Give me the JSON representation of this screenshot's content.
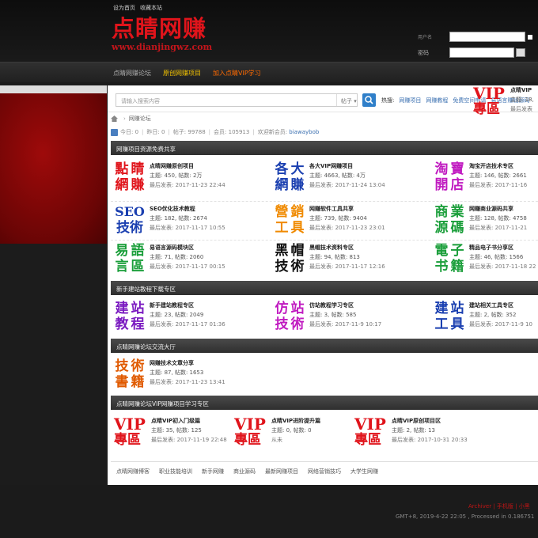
{
  "top": {
    "links": [
      "设为首页",
      "收藏本站"
    ],
    "logo_cn": "点睛网赚",
    "logo_en": "www.dianjingwz.com"
  },
  "login": {
    "user_label": "用户名",
    "password_label": "密码"
  },
  "nav": {
    "items": [
      "点睛网赚论坛",
      "原创网赚项目",
      "加入点睛VIP学习"
    ]
  },
  "search": {
    "placeholder": "请输入搜索内容",
    "scope": "帖子",
    "hot_label": "热搜:",
    "hot_items": [
      "网赚项目",
      "网赚教程",
      "免费空间申请",
      "易语言赚钱源码"
    ]
  },
  "breadcrumb": {
    "forum": "网赚论坛"
  },
  "stats": {
    "today": "今日: 0",
    "yesterday": "昨日: 0",
    "posts": "帖子: 99788",
    "members": "会员: 105913",
    "newest_label": "欢迎新会员:",
    "newest_user": "biawaybob"
  },
  "sections": [
    {
      "title": "网赚项目资源免费共享",
      "forums": [
        {
          "icon": [
            "點",
            "睛",
            "網",
            "賺"
          ],
          "colors": [
            "#e0141b",
            "#e0141b",
            "#e0141b",
            "#e0141b"
          ],
          "name": "点睛网赚原创项目",
          "meta": "主题: 450, 帖数: 2万",
          "last": "最后发表: 2017-11-23 22:44"
        },
        {
          "icon": [
            "各",
            "大",
            "網",
            "賺"
          ],
          "colors": [
            "#1a3fb0",
            "#1a3fb0",
            "#1a3fb0",
            "#1a3fb0"
          ],
          "name": "各大VIP网赚项目",
          "meta": "主题: 4663, 帖数: 4万",
          "last": "最后发表: 2017-11-24 13:04"
        },
        {
          "icon": [
            "淘",
            "寶",
            "開",
            "店"
          ],
          "colors": [
            "#c01ac0",
            "#c01ac0",
            "#c01ac0",
            "#c01ac0"
          ],
          "name": "淘宝开店技术专区",
          "meta": "主题: 146, 帖数: 2661",
          "last": "最后发表: 2017-11-16"
        },
        {
          "icon": [
            "S",
            "E",
            "技",
            "術"
          ],
          "colors": [
            "#1a3fb0",
            "#1a3fb0",
            "#1a3fb0",
            "#1a3fb0"
          ],
          "name": "SEO优化技术教程",
          "meta": "主题: 182, 帖数: 2674",
          "last": "最后发表: 2017-11-17 10:55",
          "seo": "SEO"
        },
        {
          "icon": [
            "營",
            "銷",
            "工",
            "具"
          ],
          "colors": [
            "#f08a00",
            "#f08a00",
            "#f08a00",
            "#f08a00"
          ],
          "name": "网赚软件工具共享",
          "meta": "主题: 739, 帖数: 9404",
          "last": "最后发表: 2017-11-23 23:01"
        },
        {
          "icon": [
            "商",
            "業",
            "源",
            "碼"
          ],
          "colors": [
            "#1a9e3a",
            "#1a9e3a",
            "#1a9e3a",
            "#1a9e3a"
          ],
          "name": "网赚商业源码共享",
          "meta": "主题: 128, 帖数: 4758",
          "last": "最后发表: 2017-11-21"
        },
        {
          "icon": [
            "易",
            "語",
            "言",
            "區"
          ],
          "colors": [
            "#1a9e3a",
            "#1a9e3a",
            "#1a9e3a",
            "#1a9e3a"
          ],
          "name": "易语言源码模块区",
          "meta": "主题: 71, 帖数: 2060",
          "last": "最后发表: 2017-11-17 00:15"
        },
        {
          "icon": [
            "黑",
            "帽",
            "技",
            "術"
          ],
          "colors": [
            "#111",
            "#111",
            "#111",
            "#111"
          ],
          "name": "黑帽技术资料专区",
          "meta": "主题: 94, 帖数: 813",
          "last": "最后发表: 2017-11-17 12:16"
        },
        {
          "icon": [
            "電",
            "子",
            "书",
            "籍"
          ],
          "colors": [
            "#1a9e3a",
            "#1a9e3a",
            "#1a9e3a",
            "#1a9e3a"
          ],
          "name": "精品电子书分享区",
          "meta": "主题: 46, 帖数: 1566",
          "last": "最后发表: 2017-11-18 22"
        }
      ]
    },
    {
      "title": "新手建站教程下载专区",
      "forums": [
        {
          "icon": [
            "建",
            "站",
            "教",
            "程"
          ],
          "colors": [
            "#7a1ac0",
            "#7a1ac0",
            "#7a1ac0",
            "#7a1ac0"
          ],
          "name": "新手建站教程专区",
          "meta": "主题: 23, 帖数: 2049",
          "last": "最后发表: 2017-11-17 01:36"
        },
        {
          "icon": [
            "仿",
            "站",
            "技",
            "術"
          ],
          "colors": [
            "#c01ac0",
            "#c01ac0",
            "#c01ac0",
            "#c01ac0"
          ],
          "name": "仿站教程学习专区",
          "meta": "主题: 3, 帖数: 585",
          "last": "最后发表: 2017-11-9 10:17"
        },
        {
          "icon": [
            "建",
            "站",
            "工",
            "具"
          ],
          "colors": [
            "#1a3fb0",
            "#1a3fb0",
            "#1a3fb0",
            "#1a3fb0"
          ],
          "name": "建站相关工具专区",
          "meta": "主题: 2, 帖数: 352",
          "last": "最后发表: 2017-11-9 10"
        }
      ]
    },
    {
      "title": "点睛网赚论坛交流大厅",
      "forums": [
        {
          "icon": [
            "技",
            "術",
            "書",
            "籍"
          ],
          "colors": [
            "#e05a00",
            "#e05a00",
            "#e05a00",
            "#e05a00"
          ],
          "name": "网赚技术文章分享",
          "meta": "主题: 87, 帖数: 1653",
          "last": "最后发表: 2017-11-23 13:41"
        }
      ]
    },
    {
      "title": "点睛网赚论坛VIP网赚项目学习专区",
      "forums": [
        {
          "vip": [
            "VIP",
            "專區"
          ],
          "name": "点睛VIP初入门级篇",
          "meta": "主题: 35, 帖数: 125",
          "last": "最后发表: 2017-11-19 22:48"
        },
        {
          "vip": [
            "VIP",
            "專區"
          ],
          "name": "点睛VIP进阶提升篇",
          "meta": "主题: 0, 帖数: 0",
          "last": "从未"
        },
        {
          "vip": [
            "VIP",
            "專區"
          ],
          "name": "点睛VIP原创项目区",
          "meta": "主题: 2, 帖数: 13",
          "last": "最后发表: 2017-10-31 20:33"
        },
        {
          "vip": [
            "VIP",
            "專區"
          ],
          "name": "点睛VIP",
          "meta": "主题: 18,",
          "last": "最后发表"
        }
      ]
    }
  ],
  "bottom_links": [
    "点睛网赚博客",
    "职业技能培训",
    "新手网赚",
    "商业源码",
    "最新网赚项目",
    "网络营销技巧",
    "大学生网赚"
  ],
  "footer": {
    "links": "Archiver | 手机版 | 小黑",
    "info": "GMT+8, 2019-4-22 22:05 , Processed in 0.186751"
  },
  "colors": {
    "brand_red": "#e0141b",
    "header_bg": "#111111",
    "section_bar": "#3a3a3a",
    "link_blue": "#3a6fb0"
  }
}
